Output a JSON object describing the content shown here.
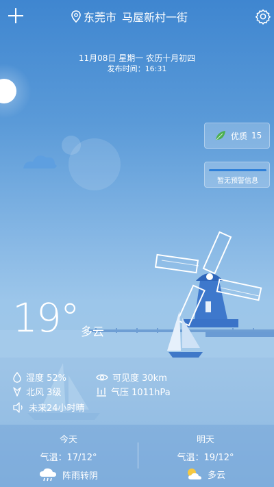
{
  "header": {
    "city": "东莞市",
    "street": "马屋新村一街"
  },
  "date_line": "11月08日 星期一 农历十月初四",
  "publish_time": "发布时间：16:31",
  "air_quality": {
    "label": "优质",
    "value": "15"
  },
  "warning": {
    "text": "暂无预警信息"
  },
  "current": {
    "temperature": "19°",
    "condition": "多云"
  },
  "details": {
    "humidity": "湿度 52%",
    "visibility": "可见度 30km",
    "wind": "北风 3级",
    "pressure": "气压 1011hPa",
    "forecast_note": "未来24小时晴"
  },
  "today": {
    "title": "今天",
    "temp": "气温：17/12°",
    "weather": "阵雨转阴"
  },
  "tomorrow": {
    "title": "明天",
    "temp": "气温：19/12°",
    "weather": "多云"
  },
  "colors": {
    "accent_bar": "#2e7fd8",
    "leaf": "#4caf50"
  }
}
